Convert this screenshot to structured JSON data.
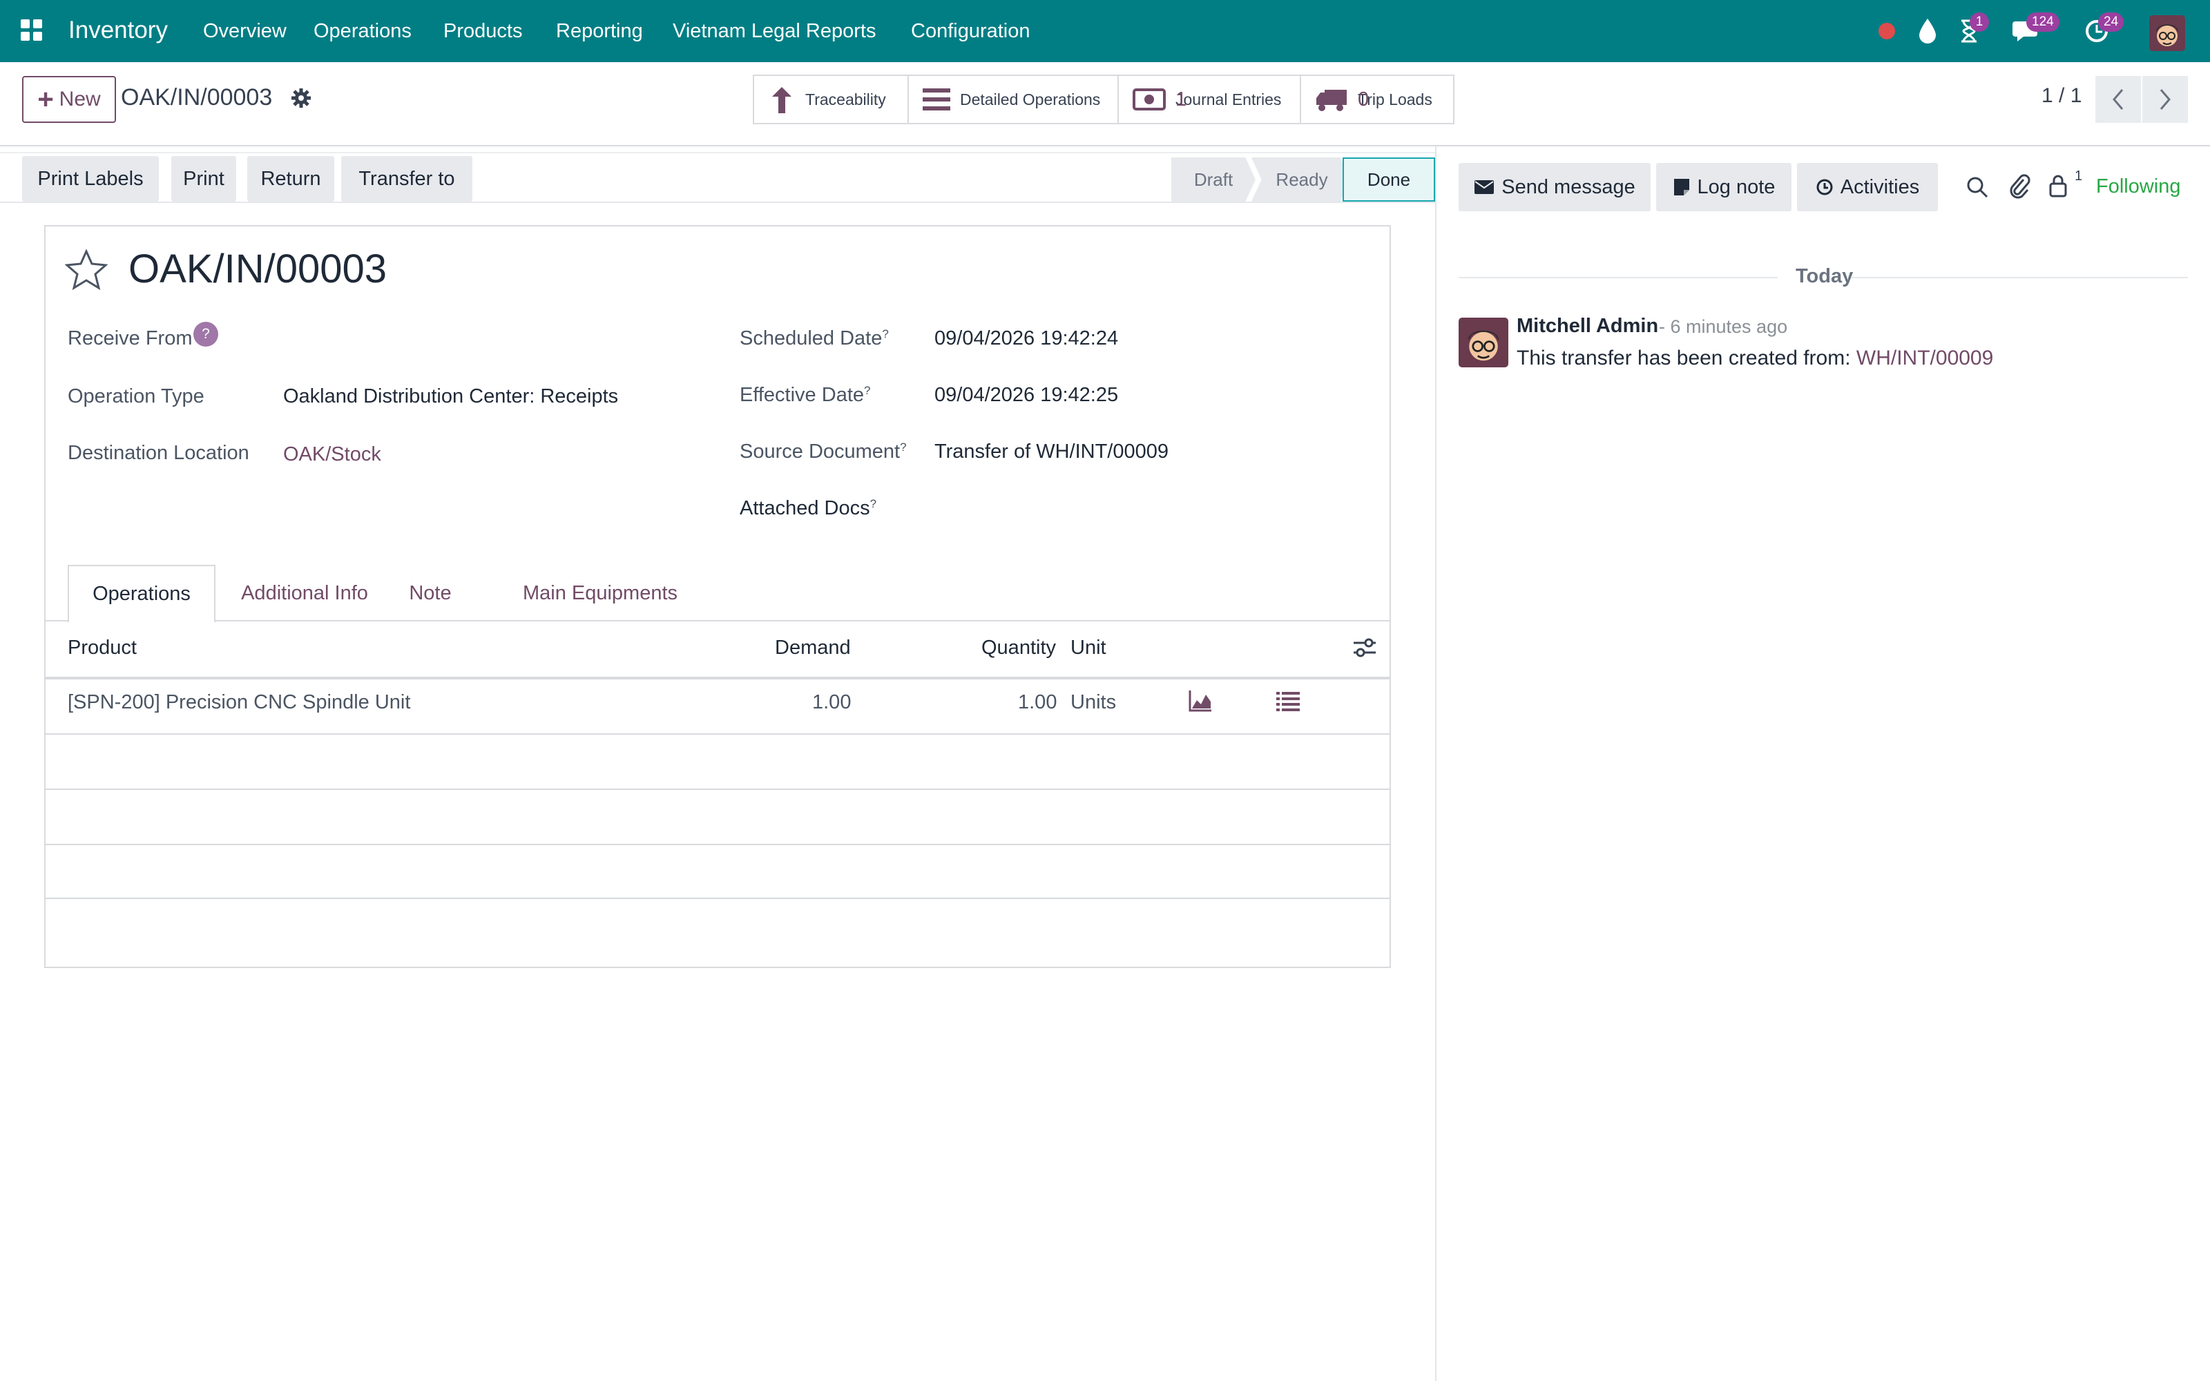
{
  "navbar": {
    "brand": "Inventory",
    "menu": [
      "Overview",
      "Operations",
      "Products",
      "Reporting",
      "Vietnam Legal Reports",
      "Configuration"
    ],
    "icons": [
      "record-dot-icon",
      "droplet-icon",
      "hourglass-icon",
      "chat-icon",
      "clock-icon"
    ],
    "badges": {
      "activities": "1",
      "messages": "124",
      "clock": "24"
    },
    "accent": "#017e84"
  },
  "control_panel": {
    "new_label": "New",
    "breadcrumb": "OAK/IN/00003",
    "smart_buttons": [
      {
        "label": "Traceability",
        "value": ""
      },
      {
        "label": "Detailed Operations",
        "value": ""
      },
      {
        "label": "Journal Entries",
        "value": "1"
      },
      {
        "label": "Trip Loads",
        "value": "0"
      }
    ],
    "pager": "1 / 1"
  },
  "statusbar": {
    "actions": [
      "Print Labels",
      "Print",
      "Return",
      "Transfer to"
    ],
    "stages": [
      "Draft",
      "Ready",
      "Done"
    ],
    "current_stage": "Done"
  },
  "form": {
    "title": "OAK/IN/00003",
    "receive_from_label": "Receive From",
    "receive_from_help": "?",
    "operation_type_label": "Operation Type",
    "operation_type": "Oakland Distribution Center: Receipts",
    "destination_label": "Destination Location",
    "destination": "OAK/Stock",
    "scheduled_label": "Scheduled Date",
    "scheduled": "09/04/2026 19:42:24",
    "effective_label": "Effective Date",
    "effective": "09/04/2026 19:42:25",
    "source_label": "Source Document",
    "source": "Transfer of WH/INT/00009",
    "attached_label": "Attached Docs",
    "help_mark": "?"
  },
  "tabs": [
    "Operations",
    "Additional Info",
    "Note",
    "Main Equipments"
  ],
  "table": {
    "headers": {
      "product": "Product",
      "demand": "Demand",
      "quantity": "Quantity",
      "unit": "Unit"
    },
    "rows": [
      {
        "product": "[SPN-200] Precision CNC Spindle Unit",
        "demand": "1.00",
        "quantity": "1.00",
        "unit": "Units"
      }
    ]
  },
  "chatter": {
    "send_message": "Send message",
    "log_note": "Log note",
    "activities": "Activities",
    "followers_count": "1",
    "following": "Following",
    "day": "Today",
    "message": {
      "author": "Mitchell Admin",
      "when": "- 6 minutes ago",
      "body": "This transfer has been created from: ",
      "link": "WH/INT/00009"
    }
  }
}
